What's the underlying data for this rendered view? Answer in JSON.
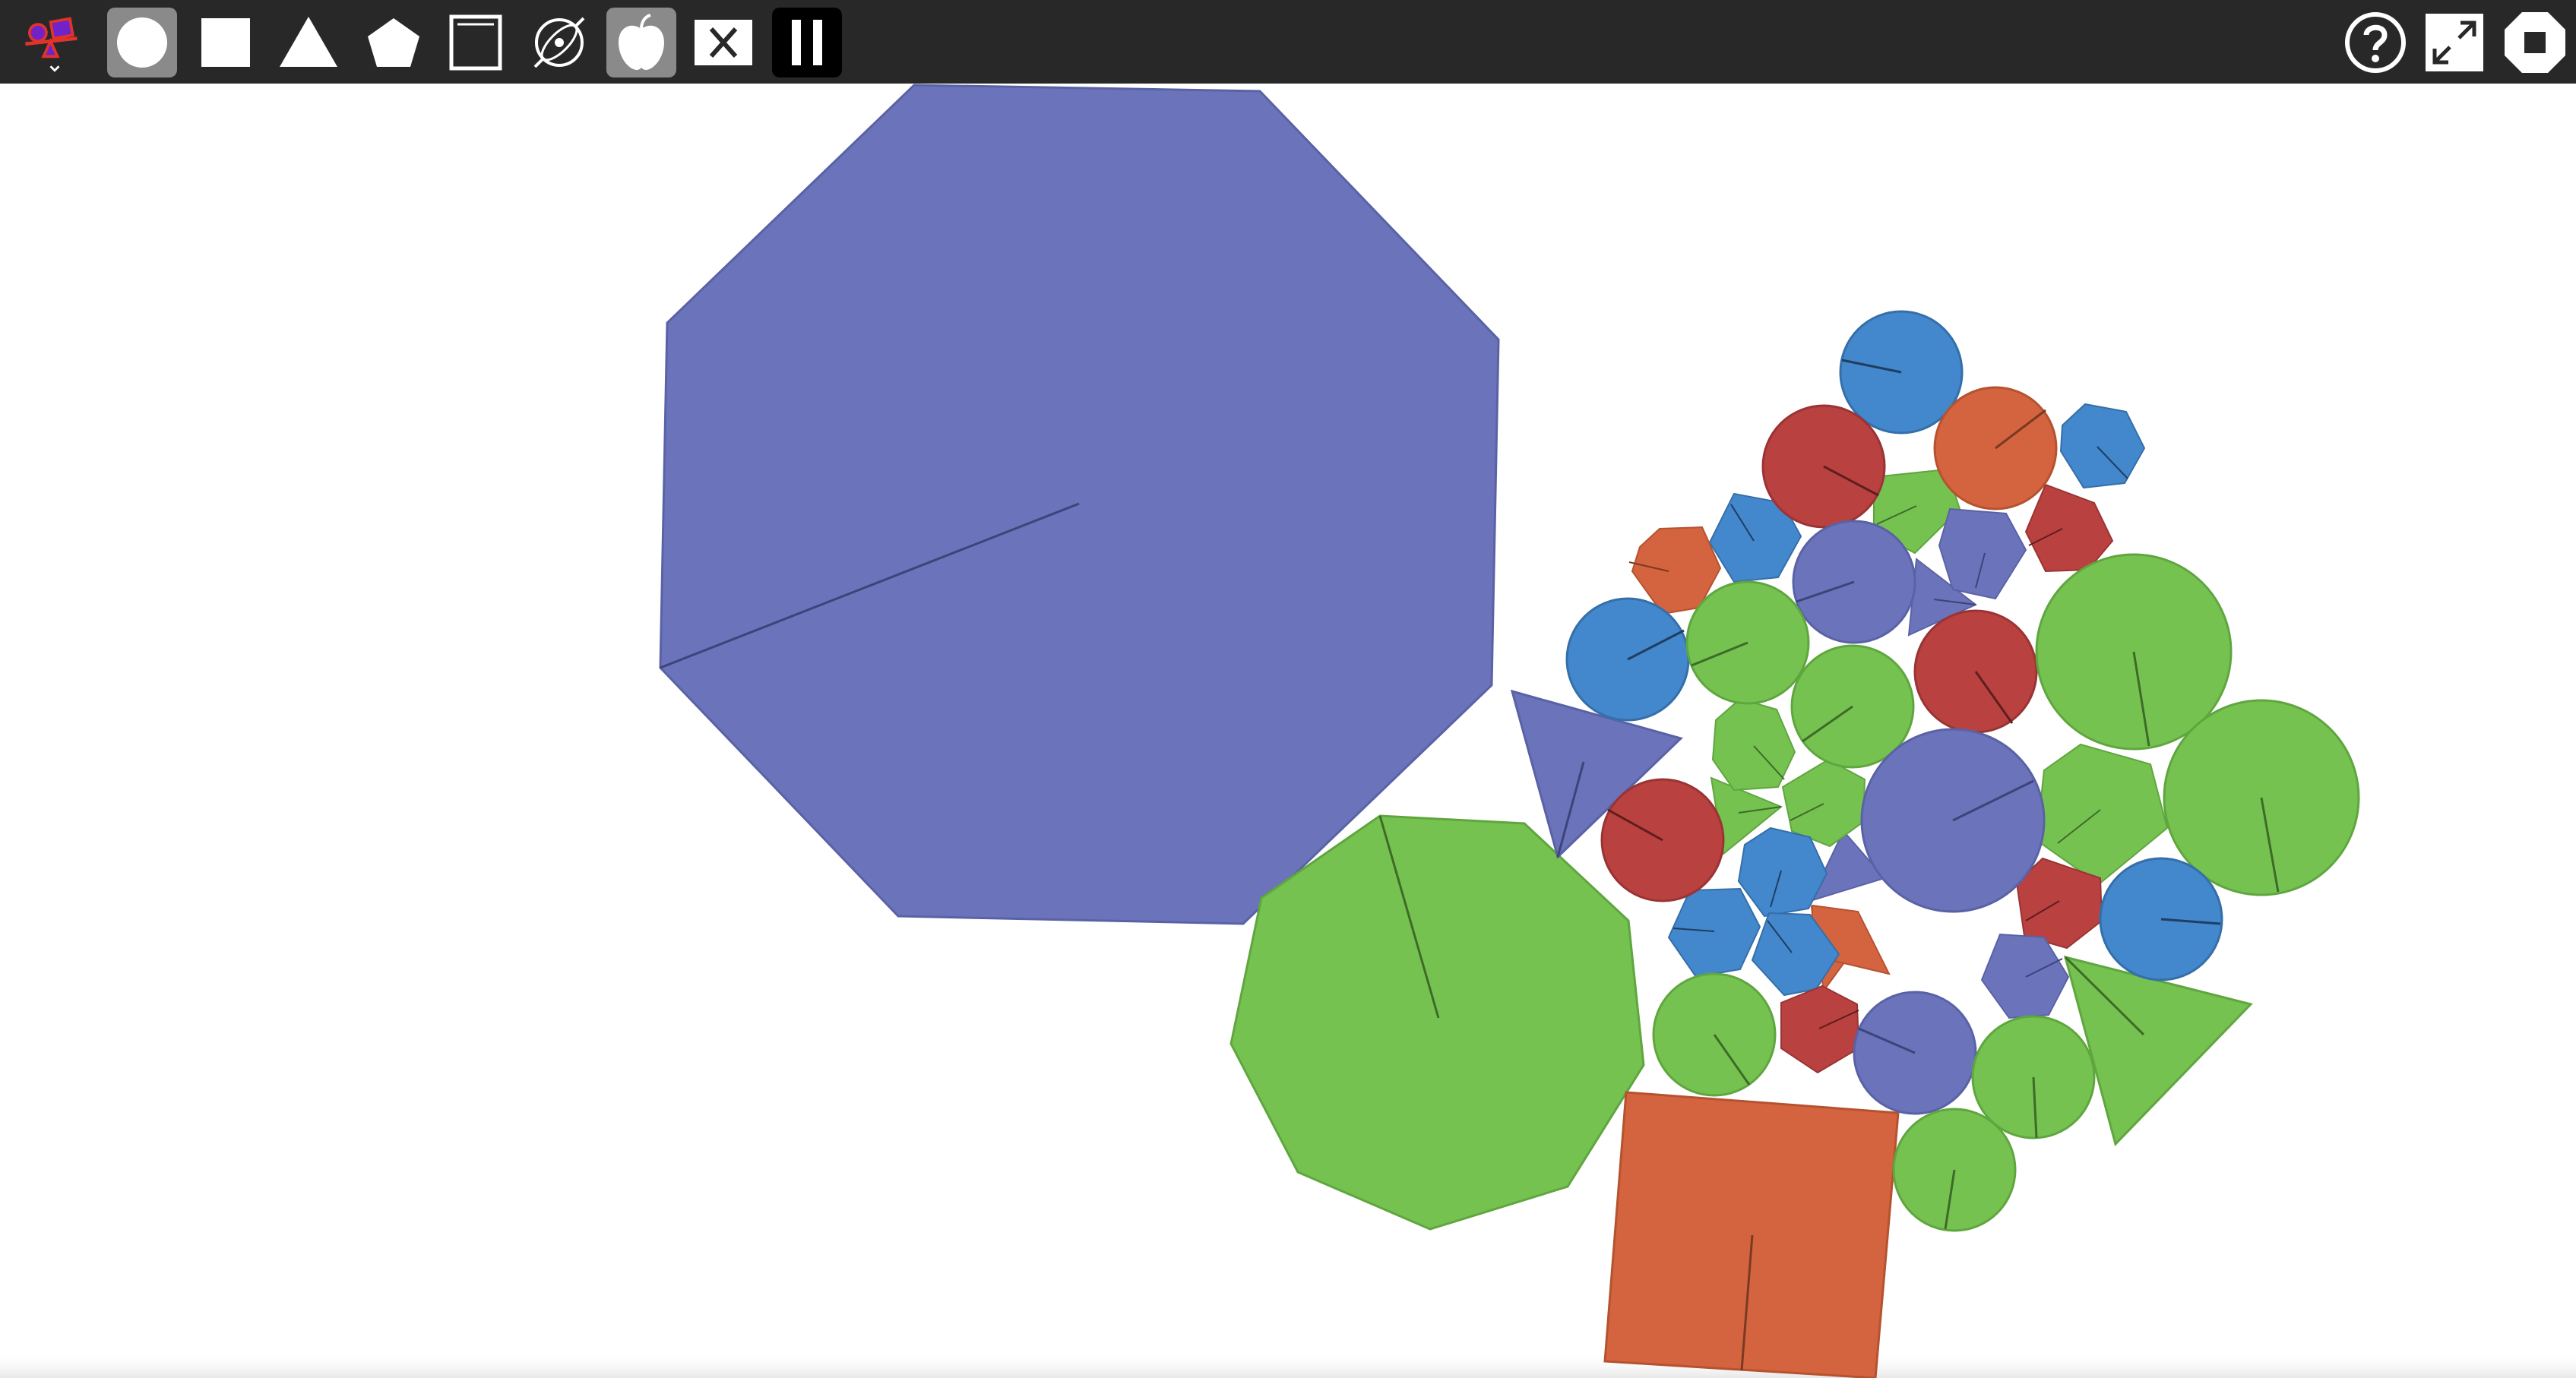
{
  "toolbar": {
    "tools": [
      {
        "name": "physics-activity-menu-button",
        "icon": "activity-logo-icon",
        "selected": false
      },
      {
        "name": "circle-tool-button",
        "icon": "circle-icon",
        "selected": true
      },
      {
        "name": "square-tool-button",
        "icon": "square-icon",
        "selected": false
      },
      {
        "name": "triangle-tool-button",
        "icon": "triangle-icon",
        "selected": false
      },
      {
        "name": "pentagon-tool-button",
        "icon": "pentagon-icon",
        "selected": false
      },
      {
        "name": "clear-box-tool-button",
        "icon": "box-icon",
        "selected": false
      },
      {
        "name": "motion-sensor-button",
        "icon": "orbit-icon",
        "selected": false
      },
      {
        "name": "gravity-button",
        "icon": "apple-icon",
        "selected": true
      },
      {
        "name": "clear-all-button",
        "icon": "x-icon",
        "selected": false
      },
      {
        "name": "pause-button",
        "icon": "pause-icon",
        "selected": false
      },
      {
        "name": "help-button",
        "icon": "help-icon",
        "selected": false
      },
      {
        "name": "fullscreen-button",
        "icon": "fullscreen-icon",
        "selected": false
      },
      {
        "name": "stop-button",
        "icon": "stop-icon",
        "selected": false
      }
    ]
  },
  "colors": {
    "toolbar_bg": "#282828",
    "selected_tool_bg": "#8a8a8a",
    "purple": "#6b73bb",
    "green": "#76c251",
    "orange": "#d4643f",
    "red": "#b94140",
    "blue": "#4387cc",
    "accent_red": "#e2332a",
    "accent_purple": "#6f23c8"
  },
  "shapes": [
    {
      "kind": "octagon",
      "color": "purple"
    },
    {
      "kind": "nonagon",
      "color": "green"
    },
    {
      "kind": "square",
      "color": "orange"
    },
    {
      "kind": "triangle",
      "color": "purple"
    },
    {
      "kind": "triangle",
      "color": "green"
    },
    {
      "kind": "triangle",
      "color": "orange"
    },
    {
      "kind": "triangle",
      "color": "orange"
    },
    {
      "kind": "triangle",
      "color": "purple"
    },
    {
      "kind": "triangle",
      "color": "green"
    },
    {
      "kind": "triangle",
      "color": "purple"
    },
    {
      "kind": "pentagon",
      "color": "green"
    },
    {
      "kind": "pentagon",
      "color": "green"
    },
    {
      "kind": "pentagon",
      "color": "purple"
    },
    {
      "kind": "hexagon",
      "color": "green"
    },
    {
      "kind": "hexagon",
      "color": "green"
    },
    {
      "kind": "hexagon",
      "color": "blue"
    },
    {
      "kind": "hexagon",
      "color": "blue"
    },
    {
      "kind": "hexagon",
      "color": "orange"
    },
    {
      "kind": "hexagon",
      "color": "red"
    },
    {
      "kind": "hexagon",
      "color": "blue"
    },
    {
      "kind": "hexagon",
      "color": "blue"
    },
    {
      "kind": "hexagon",
      "color": "blue"
    },
    {
      "kind": "hexagon",
      "color": "red"
    },
    {
      "kind": "hexagon",
      "color": "red"
    },
    {
      "kind": "hexagon",
      "color": "purple"
    },
    {
      "kind": "circle",
      "color": "blue"
    },
    {
      "kind": "circle",
      "color": "orange"
    },
    {
      "kind": "circle",
      "color": "red"
    },
    {
      "kind": "circle",
      "color": "purple"
    },
    {
      "kind": "circle",
      "color": "blue"
    },
    {
      "kind": "circle",
      "color": "green"
    },
    {
      "kind": "circle",
      "color": "red"
    },
    {
      "kind": "circle",
      "color": "green"
    },
    {
      "kind": "circle",
      "color": "green"
    },
    {
      "kind": "circle",
      "color": "purple"
    },
    {
      "kind": "circle",
      "color": "green"
    },
    {
      "kind": "circle",
      "color": "red"
    },
    {
      "kind": "circle",
      "color": "blue"
    },
    {
      "kind": "circle",
      "color": "green"
    },
    {
      "kind": "circle",
      "color": "purple"
    },
    {
      "kind": "circle",
      "color": "green"
    },
    {
      "kind": "circle",
      "color": "green"
    }
  ]
}
